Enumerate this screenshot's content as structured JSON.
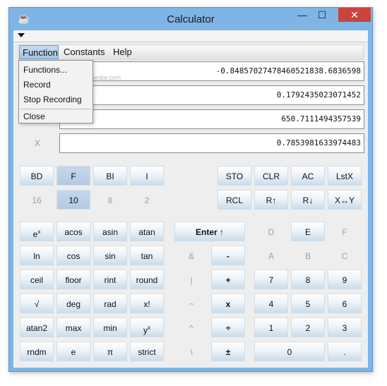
{
  "window": {
    "title": "Calculator",
    "minimize": "—",
    "maximize": "☐",
    "close": "✕",
    "app_icon": "cup-icon"
  },
  "menubar": {
    "items": [
      "Function",
      "Constants",
      "Help"
    ]
  },
  "dropdown": {
    "items": [
      "Functions...",
      "Record",
      "Stop Recording",
      "Close"
    ]
  },
  "watermark": "softpedia.com",
  "registers": [
    {
      "label": "",
      "value": "-0.84857027478460521838.6836598"
    },
    {
      "label": "",
      "value": "0.1792435023071452"
    },
    {
      "label": "",
      "value": "650.7111494357539"
    },
    {
      "label": "X",
      "value": "0.7853981633974483"
    }
  ],
  "buttons": {
    "bd": "BD",
    "f": "F",
    "bi": "BI",
    "i": "I",
    "sto": "STO",
    "clr": "CLR",
    "ac": "AC",
    "lstx": "LstX",
    "b16": "16",
    "b10": "10",
    "b8": "8",
    "b2": "2",
    "rcl": "RCL",
    "rup": "R↑",
    "rdown": "R↓",
    "xswap": "X↔Y",
    "ex_base": "e",
    "ex_sup": "x",
    "acos": "acos",
    "asin": "asin",
    "atan": "atan",
    "enter": "Enter ↑",
    "d": "D",
    "e_hex": "E",
    "f_hex": "F",
    "ln": "ln",
    "cos": "cos",
    "sin": "sin",
    "tan": "tan",
    "amp": "&",
    "minus": "-",
    "a": "A",
    "b": "B",
    "c": "C",
    "ceil": "ceil",
    "floor": "floor",
    "rint": "rint",
    "round": "round",
    "pipe": "|",
    "plus": "+",
    "n7": "7",
    "n8": "8",
    "n9": "9",
    "sqrt": "√",
    "deg": "deg",
    "rad": "rad",
    "fact": "x!",
    "tilde": "~",
    "times": "x",
    "n4": "4",
    "n5": "5",
    "n6": "6",
    "atan2": "atan2",
    "max": "max",
    "min": "min",
    "yx_base": "y",
    "yx_sup": "x",
    "caret": "^",
    "divide": "÷",
    "n1": "1",
    "n2": "2",
    "n3": "3",
    "rndm": "rndm",
    "e_const": "e",
    "pi": "π",
    "strict": "strict",
    "backslash": "\\",
    "plusminus": "±",
    "n0": "0",
    "dot": "."
  }
}
